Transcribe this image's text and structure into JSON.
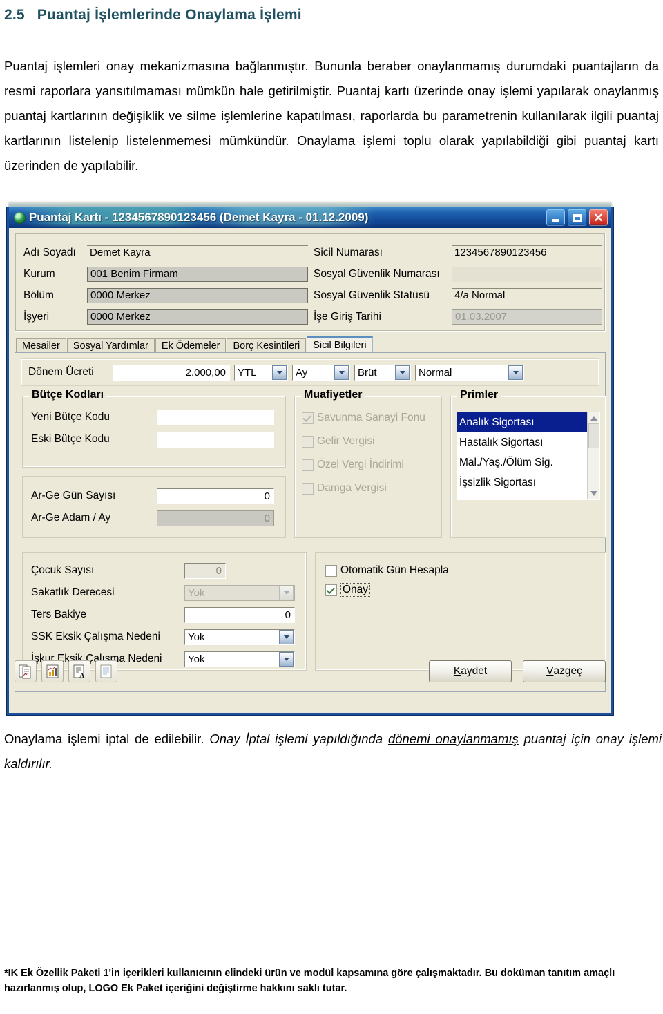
{
  "document": {
    "heading_number": "2.5",
    "heading_text": "Puantaj İşlemlerinde Onaylama İşlemi",
    "intro_paragraph": "Puantaj işlemleri onay mekanizmasına bağlanmıştır. Bununla beraber onaylanmamış durumdaki puantajların da resmi raporlara yansıtılmaması mümkün hale getirilmiştir. Puantaj kartı üzerinde  onay işlemi yapılarak onaylanmış puantaj kartlarının değişiklik ve silme işlemlerine kapatılması, raporlarda bu parametrenin kullanılarak ilgili puantaj kartlarının listelenip listelenmemesi mümkündür. Onaylama işlemi toplu olarak yapılabildiği gibi puantaj kartı üzerinden de yapılabilir.",
    "cancel_paragraph": {
      "plain_1": "Onaylama işlemi iptal de edilebilir. ",
      "italic_1": "Onay İptal işlemi yapıldığında ",
      "underlined": "dönemi onaylanmamış",
      "italic_2": " puantaj için onay işlemi kaldırılır."
    },
    "footnote": "*IK Ek Özellik Paketi 1'in içerikleri kullanıcının elindeki ürün ve modül kapsamına göre çalışmaktadır. Bu doküman tanıtım amaçlı hazırlanmış olup, LOGO Ek Paket içeriğini değiştirme hakkını saklı tutar."
  },
  "window": {
    "title": "Puantaj Kartı - 1234567890123456 (Demet Kayra - 01.12.2009)",
    "icon": "app-globe-icon",
    "controls": {
      "minimize": "minimize-icon",
      "maximize": "maximize-icon",
      "close": "close-icon"
    },
    "accent_title_color": "#1d5fae",
    "face_color": "#ece9d8"
  },
  "header_form": {
    "left": [
      {
        "label": "Adı Soyadı",
        "value": "Demet Kayra",
        "style": "flat"
      },
      {
        "label": "Kurum",
        "value": "001  Benim Firmam",
        "style": "grey"
      },
      {
        "label": "Bölüm",
        "value": "0000 Merkez",
        "style": "grey"
      },
      {
        "label": "İşyeri",
        "value": "0000 Merkez",
        "style": "grey"
      }
    ],
    "right": [
      {
        "label": "Sicil Numarası",
        "value": "1234567890123456",
        "style": "flat"
      },
      {
        "label": "Sosyal Güvenlik Numarası",
        "value": "",
        "style": "empty-flat"
      },
      {
        "label": "Sosyal Güvenlik Statüsü",
        "value": "4/a Normal",
        "style": "flat"
      },
      {
        "label": "İşe Giriş Tarihi",
        "value": "01.03.2007",
        "style": "dim"
      }
    ]
  },
  "tabs": [
    {
      "label": "Mesailer",
      "active": false
    },
    {
      "label": "Sosyal Yardımlar",
      "active": false
    },
    {
      "label": "Ek Ödemeler",
      "active": false
    },
    {
      "label": "Borç Kesintileri",
      "active": false
    },
    {
      "label": "Sicil Bilgileri",
      "active": true
    }
  ],
  "wage_row": {
    "label": "Dönem Ücreti",
    "amount": "2.000,00",
    "currency": "YTL",
    "period": "Ay",
    "type": "Brüt",
    "kind": "Normal"
  },
  "budget_group": {
    "legend": "Bütçe Kodları",
    "rows": [
      {
        "label": "Yeni Bütçe Kodu",
        "value": ""
      },
      {
        "label": "Eski Bütçe Kodu",
        "value": ""
      }
    ]
  },
  "arge_group": {
    "rows": [
      {
        "label": "Ar-Ge Gün Sayısı",
        "value": "0",
        "disabled": false
      },
      {
        "label": "Ar-Ge Adam / Ay",
        "value": "0",
        "disabled": true
      }
    ]
  },
  "exemptions_group": {
    "legend": "Muafiyetler",
    "items": [
      {
        "label": "Savunma Sanayi Fonu",
        "checked": true,
        "disabled": true
      },
      {
        "label": "Gelir Vergisi",
        "checked": false,
        "disabled": true
      },
      {
        "label": "Özel Vergi İndirimi",
        "checked": false,
        "disabled": true
      },
      {
        "label": "Damga Vergisi",
        "checked": false,
        "disabled": true
      }
    ]
  },
  "premiums_group": {
    "legend": "Primler",
    "items": [
      {
        "label": "Analık Sigortası",
        "selected": true
      },
      {
        "label": "Hastalık Sigortası",
        "selected": false
      },
      {
        "label": "Mal./Yaş./Ölüm Sig.",
        "selected": false
      },
      {
        "label": "İşsizlik Sigortası",
        "selected": false
      }
    ],
    "scrollbar": {
      "up": "scroll-up-icon",
      "down": "scroll-down-icon"
    }
  },
  "child_group": {
    "rows": [
      {
        "label": "Çocuk Sayısı",
        "value": "0",
        "kind": "text",
        "disabled": true
      },
      {
        "label": "Sakatlık Derecesi",
        "value": "Yok",
        "kind": "combo",
        "disabled": true
      },
      {
        "label": "Ters Bakiye",
        "value": "0",
        "kind": "text",
        "disabled": false
      },
      {
        "label": "SSK Eksik Çalışma Nedeni",
        "value": "Yok",
        "kind": "combo",
        "disabled": false
      },
      {
        "label": "İşkur Eksik Çalışma Nedeni",
        "value": "Yok",
        "kind": "combo",
        "disabled": false
      }
    ]
  },
  "options_group": {
    "items": [
      {
        "label": "Otomatik Gün Hesapla",
        "checked": false,
        "focused": false
      },
      {
        "label": "Onay",
        "checked": true,
        "focused": true
      }
    ]
  },
  "bottom_bar": {
    "tools": [
      {
        "name": "report-note-icon"
      },
      {
        "name": "chart-report-icon"
      },
      {
        "name": "text-report-icon"
      },
      {
        "name": "list-report-icon"
      }
    ],
    "save_label_prefix": "K",
    "save_label_rest": "aydet",
    "cancel_label_prefix": "V",
    "cancel_label_rest": "azgeç"
  }
}
